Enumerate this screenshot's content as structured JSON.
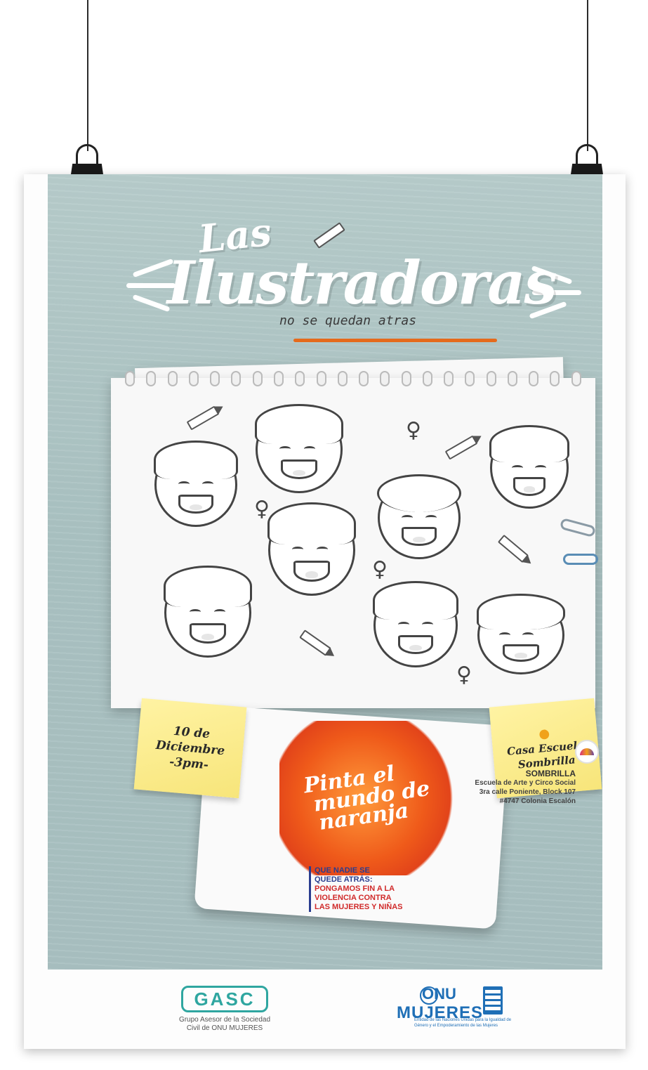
{
  "title": {
    "line1": "Las",
    "line2": "Ilustradoras",
    "subtitle": "no se quedan atras"
  },
  "date_note": {
    "line1": "10 de",
    "line2": "Diciembre",
    "line3": "-3pm-"
  },
  "location_note": {
    "icon": "location-pin-icon",
    "line1": "Casa Escuela",
    "line2": "Sombrilla"
  },
  "campaign": {
    "line1": "Pinta el",
    "line2": "mundo de",
    "line3": "naranja",
    "slogan_1": "QUE NADIE SE",
    "slogan_2": "QUEDE ATRÁS:",
    "slogan_3": "PONGAMOS FIN A LA",
    "slogan_4": "VIOLENCIA CONTRA",
    "slogan_5": "LAS MUJERES Y NIÑAS"
  },
  "venue": {
    "name": "SOMBRILLA",
    "line1": "Escuela de Arte y Circo Social",
    "line2": "3ra calle Poniente, Block 107",
    "line3": "#4747 Colonia Escalón"
  },
  "sponsors": {
    "gasc": {
      "logo_text": "GASC",
      "sub1": "Grupo Asesor de la Sociedad",
      "sub2": "Civil de ONU MUJERES"
    },
    "onu": {
      "line1": "ONU",
      "line2": "MUJERES",
      "sub": "Entidad de las Naciones Unidas para la Igualdad de Género y el Empoderamiento de las Mujeres"
    }
  },
  "colors": {
    "background": "#aac2c2",
    "accent_orange": "#ef5a1a",
    "note_yellow": "#fff3a3",
    "gasc_teal": "#2fa6a0",
    "onu_blue": "#1f6fb6"
  }
}
